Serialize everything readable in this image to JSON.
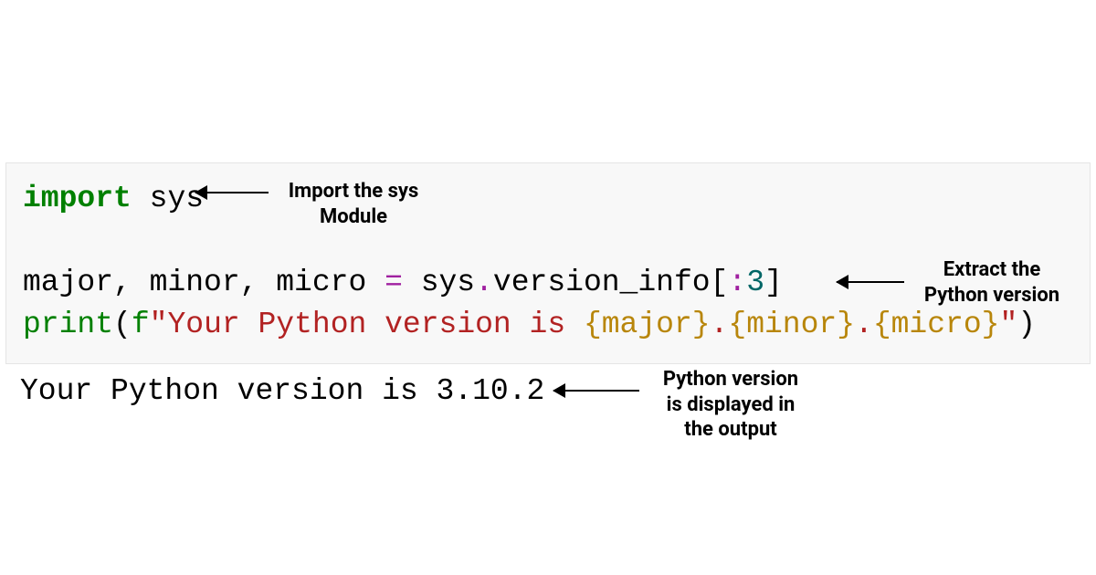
{
  "code": {
    "line1": {
      "kw": "import",
      "sp": " ",
      "mod": "sys"
    },
    "line2": {
      "lhs": "major, minor, micro ",
      "op": "=",
      "rhs_a": " sys",
      "rhs_b": ".",
      "rhs_c": "version_info[",
      "rhs_d": ":",
      "rhs_e": "3",
      "rhs_f": "]"
    },
    "line3": {
      "fn": "print",
      "open": "(",
      "prefix": "f",
      "q1": "\"",
      "s1": "Your Python version is ",
      "ib1": "{major}",
      "dot1": ".",
      "ib2": "{minor}",
      "dot2": ".",
      "ib3": "{micro}",
      "q2": "\"",
      "close": ")"
    }
  },
  "output": "Your Python version is 3.10.2",
  "annotations": {
    "a1_l1": "Import the sys",
    "a1_l2": "Module",
    "a2_l1": "Extract the",
    "a2_l2": "Python version",
    "a3_l1": "Python version",
    "a3_l2": "is displayed in",
    "a3_l3": "the output"
  }
}
